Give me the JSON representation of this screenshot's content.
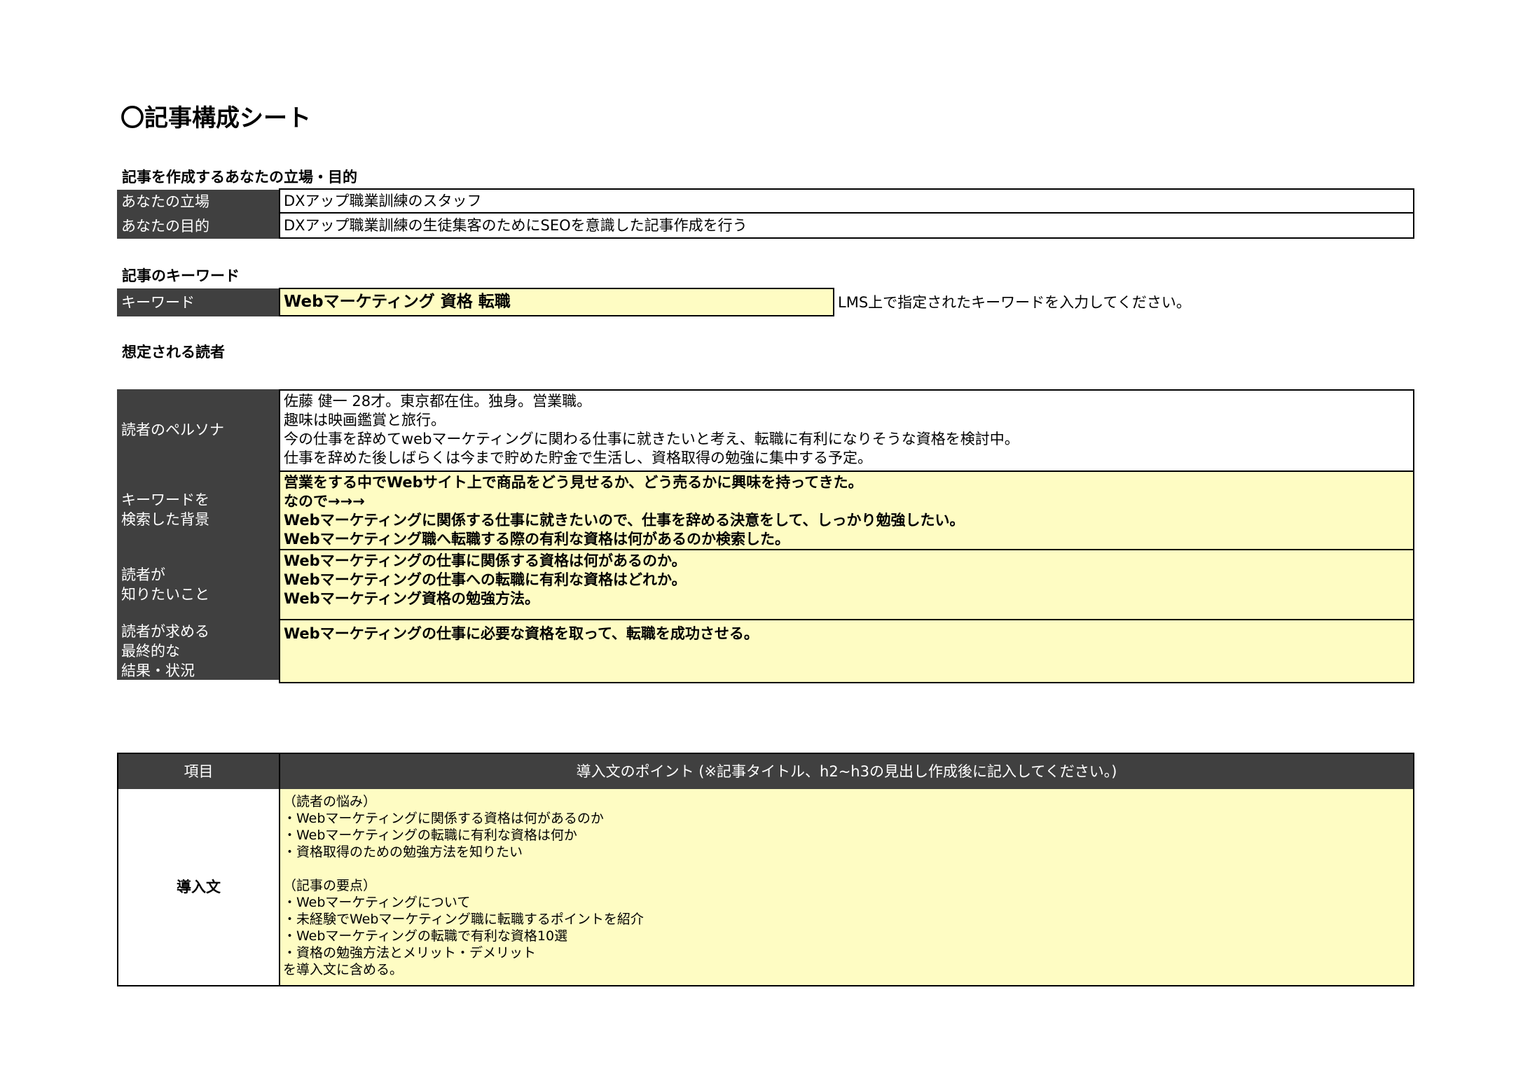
{
  "page": {
    "title": "〇記事構成シート"
  },
  "position_section": {
    "heading": "記事を作成するあなたの立場・目的",
    "rows": [
      {
        "label": "あなたの立場",
        "value": "DXアップ職業訓練のスタッフ"
      },
      {
        "label": "あなたの目的",
        "value": "DXアップ職業訓練の生徒集客のためにSEOを意識した記事作成を行う"
      }
    ]
  },
  "keyword_section": {
    "heading": "記事のキーワード",
    "label": "キーワード",
    "value": "Webマーケティング 資格 転職",
    "hint": "LMS上で指定されたキーワードを入力してください。"
  },
  "reader_section": {
    "heading": "想定される読者",
    "persona": {
      "label": "読者のペルソナ",
      "lines": [
        "佐藤 健一 28才。東京都在住。独身。営業職。",
        "趣味は映画鑑賞と旅行。",
        "今の仕事を辞めてwebマーケティングに関わる仕事に就きたいと考え、転職に有利になりそうな資格を検討中。",
        "仕事を辞めた後しばらくは今まで貯めた貯金で生活し、資格取得の勉強に集中する予定。"
      ]
    },
    "background": {
      "label_lines": [
        "キーワードを",
        "検索した背景"
      ],
      "lines": [
        "営業をする中でWebサイト上で商品をどう見せるか、どう売るかに興味を持ってきた。",
        "なので→→→",
        "Webマーケティングに関係する仕事に就きたいので、仕事を辞める決意をして、しっかり勉強したい。",
        "Webマーケティング職へ転職する際の有利な資格は何があるのか検索した。"
      ]
    },
    "wants": {
      "label_lines": [
        "読者が",
        "知りたいこと"
      ],
      "lines": [
        "Webマーケティングの仕事に関係する資格は何があるのか。",
        "Webマーケティングの仕事への転職に有利な資格はどれか。",
        "Webマーケティング資格の勉強方法。"
      ]
    },
    "goal": {
      "label_lines": [
        "読者が求める",
        "最終的な",
        "結果・状況"
      ],
      "lines": [
        "Webマーケティングの仕事に必要な資格を取って、転職を成功させる。"
      ]
    }
  },
  "intro_table": {
    "header_item": "項目",
    "header_point": "導入文のポイント (※記事タイトル、h2~h3の見出し作成後に記入してください。)",
    "row_label": "導入文",
    "worries_heading": "（読者の悩み）",
    "worries": [
      "・Webマーケティングに関係する資格は何があるのか",
      "・Webマーケティングの転職に有利な資格は何か",
      "・資格取得のための勉強方法を知りたい"
    ],
    "points_heading": "（記事の要点）",
    "points": [
      "・Webマーケティングについて",
      "・未経験でWebマーケティング職に転職するポイントを紹介",
      "・Webマーケティングの転職で有利な資格10選",
      "・資格の勉強方法とメリット・デメリット"
    ],
    "closing": "を導入文に含める。"
  },
  "colors": {
    "label_bg": "#404040",
    "highlight_bg": "#fefcc3",
    "border": "#000000"
  }
}
